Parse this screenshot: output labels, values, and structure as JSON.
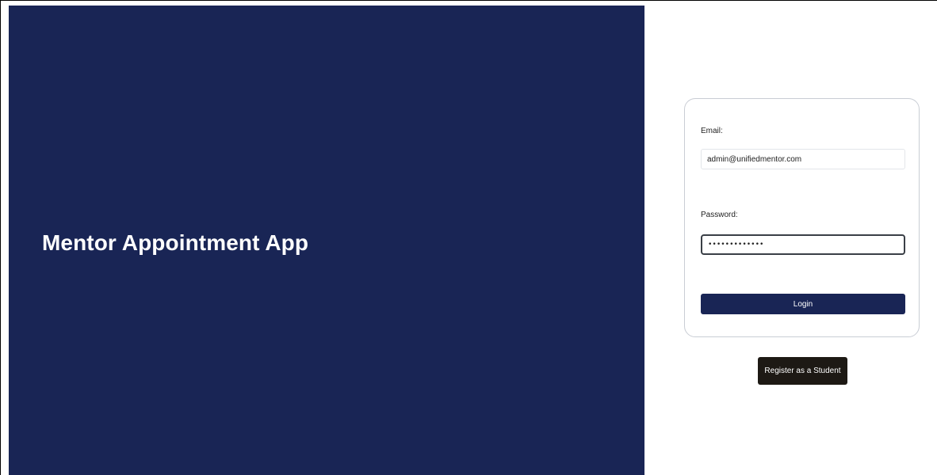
{
  "app": {
    "title": "Mentor Appointment App"
  },
  "login_form": {
    "email_label": "Email:",
    "email_value": "admin@unifiedmentor.com",
    "password_label": "Password:",
    "password_value": "•••••••••••••",
    "login_label": "Login"
  },
  "register": {
    "label": "Register as a Student"
  },
  "colors": {
    "brand_navy": "#192555",
    "register_dark": "#1d1914",
    "card_border": "#c9cdd4"
  }
}
